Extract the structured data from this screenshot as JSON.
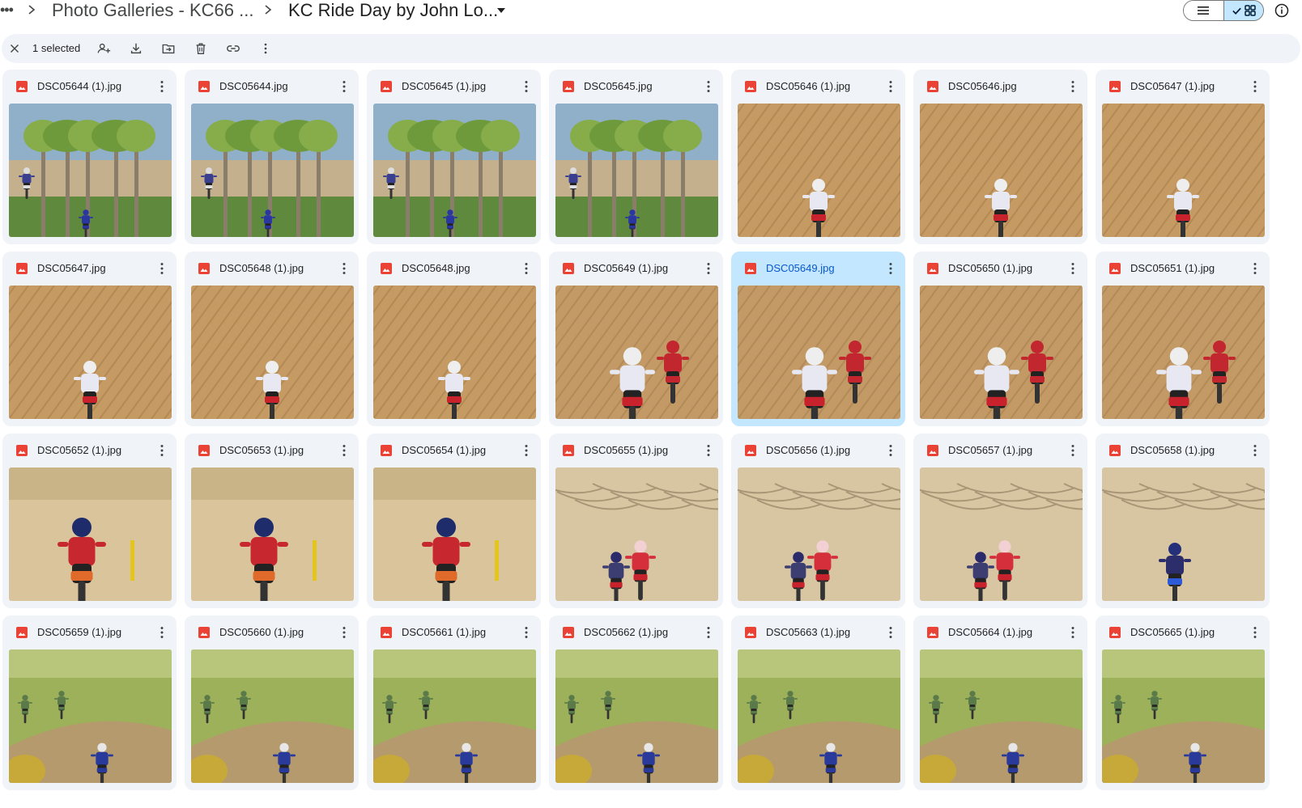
{
  "breadcrumb": {
    "overflow": "•••",
    "parent": "Photo Galleries - KC66 ...",
    "current": "KC Ride Day by John Lo..."
  },
  "toolbar": {
    "selected_text": "1 selected",
    "actions": [
      "close-icon",
      "share-icon",
      "download-icon",
      "move-icon",
      "trash-icon",
      "link-icon",
      "more-vert-icon"
    ]
  },
  "view": {
    "mode": "grid",
    "accent": "#c2e7ff",
    "selected_text_color": "#0b57d0"
  },
  "files": [
    {
      "name": "DSC05644 (1).jpg",
      "scene": "trees"
    },
    {
      "name": "DSC05644.jpg",
      "scene": "trees"
    },
    {
      "name": "DSC05645 (1).jpg",
      "scene": "trees"
    },
    {
      "name": "DSC05645.jpg",
      "scene": "trees"
    },
    {
      "name": "DSC05646 (1).jpg",
      "scene": "single"
    },
    {
      "name": "DSC05646.jpg",
      "scene": "single"
    },
    {
      "name": "DSC05647 (1).jpg",
      "scene": "single"
    },
    {
      "name": "DSC05647.jpg",
      "scene": "single"
    },
    {
      "name": "DSC05648 (1).jpg",
      "scene": "single"
    },
    {
      "name": "DSC05648.jpg",
      "scene": "single"
    },
    {
      "name": "DSC05649 (1).jpg",
      "scene": "duo"
    },
    {
      "name": "DSC05649.jpg",
      "scene": "duo",
      "selected": true
    },
    {
      "name": "DSC05650 (1).jpg",
      "scene": "duo"
    },
    {
      "name": "DSC05651 (1).jpg",
      "scene": "duo"
    },
    {
      "name": "DSC05652 (1).jpg",
      "scene": "red"
    },
    {
      "name": "DSC05653 (1).jpg",
      "scene": "red"
    },
    {
      "name": "DSC05654 (1).jpg",
      "scene": "red"
    },
    {
      "name": "DSC05655 (1).jpg",
      "scene": "track"
    },
    {
      "name": "DSC05656 (1).jpg",
      "scene": "track"
    },
    {
      "name": "DSC05657 (1).jpg",
      "scene": "track"
    },
    {
      "name": "DSC05658 (1).jpg",
      "scene": "track-blue"
    },
    {
      "name": "DSC05659 (1).jpg",
      "scene": "green"
    },
    {
      "name": "DSC05660 (1).jpg",
      "scene": "green"
    },
    {
      "name": "DSC05661 (1).jpg",
      "scene": "green"
    },
    {
      "name": "DSC05662 (1).jpg",
      "scene": "green"
    },
    {
      "name": "DSC05663 (1).jpg",
      "scene": "green"
    },
    {
      "name": "DSC05664 (1).jpg",
      "scene": "green"
    },
    {
      "name": "DSC05665 (1).jpg",
      "scene": "green"
    }
  ]
}
